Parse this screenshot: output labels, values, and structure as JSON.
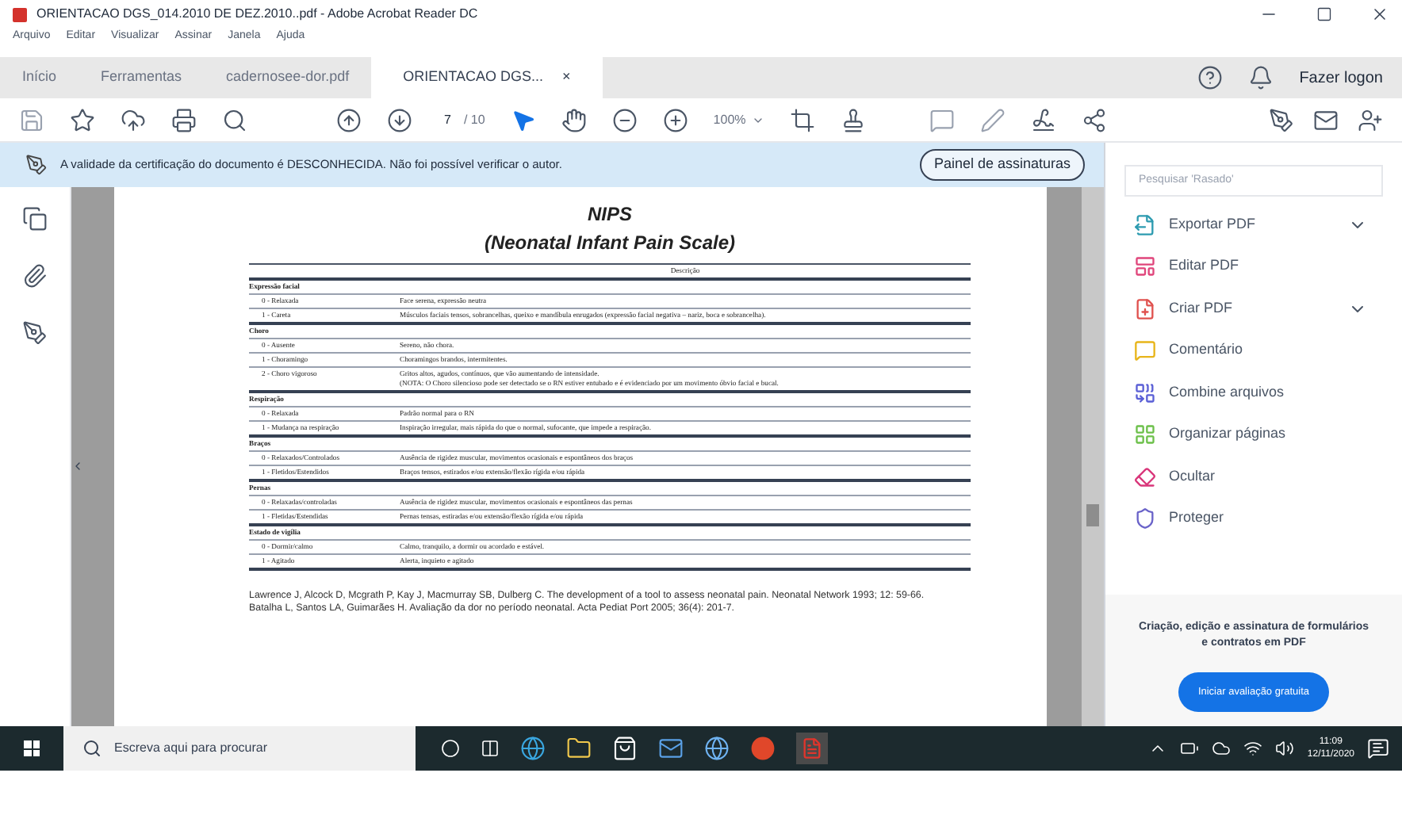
{
  "window": {
    "title": "ORIENTACAO DGS_014.2010 DE DEZ.2010..pdf - Adobe Acrobat Reader DC"
  },
  "menu": [
    "Arquivo",
    "Editar",
    "Visualizar",
    "Assinar",
    "Janela",
    "Ajuda"
  ],
  "tabs": [
    {
      "label": "Início",
      "selected": false
    },
    {
      "label": "Ferramentas",
      "selected": false
    },
    {
      "label": "cadernosee-dor.pdf",
      "selected": false
    },
    {
      "label": "ORIENTACAO DGS...",
      "selected": true,
      "close": "×"
    }
  ],
  "sign_in": "Fazer logon",
  "toolbar": {
    "page": "7",
    "page_total": "/ 10",
    "zoom": "100%"
  },
  "notification": {
    "text": "A validade da certificação do documento é DESCONHECIDA. Não foi possível verificar o autor.",
    "button": "Painel de assinaturas"
  },
  "document": {
    "title": "NIPS",
    "subtitle": "(Neonatal Infant Pain Scale)",
    "header": "Descrição",
    "sections": [
      {
        "name": "Expressão facial",
        "rows": [
          {
            "score": "0 - Relaxada",
            "description": "Face serena, expressão neutra"
          },
          {
            "score": "1 - Careta",
            "description": "Músculos faciais tensos, sobrancelhas, queixo e mandíbula enrugados (expressão facial negativa – nariz, boca e sobrancelha)."
          }
        ]
      },
      {
        "name": "Choro",
        "rows": [
          {
            "score": "0 - Ausente",
            "description": "Sereno, não chora."
          },
          {
            "score": "1 - Choramingo",
            "description": "Choramingos brandos, intermitentes."
          },
          {
            "score": "2 - Choro vigoroso",
            "description": "Gritos altos, agudos, contínuos, que vão aumentando de intensidade.",
            "note": "(NOTA: O Choro silencioso pode ser detectado se o RN estiver entubado e é evidenciado por um movimento óbvio facial e bucal."
          }
        ]
      },
      {
        "name": "Respiração",
        "rows": [
          {
            "score": "0 - Relaxada",
            "description": "Padrão normal para o RN"
          },
          {
            "score": "1 - Mudança na respiração",
            "description": "Inspiração irregular, mais rápida do que o normal, sufocante, que impede a respiração."
          }
        ]
      },
      {
        "name": "Braços",
        "rows": [
          {
            "score": "0 - Relaxados/Controlados",
            "description": "Ausência de rigidez muscular, movimentos ocasionais e espontâneos dos braços"
          },
          {
            "score": "1 - Fletidos/Estendidos",
            "description": "Braços tensos, estirados e/ou extensão/flexão rígida e/ou rápida"
          }
        ]
      },
      {
        "name": "Pernas",
        "rows": [
          {
            "score": "0 - Relaxadas/controladas",
            "description": "Ausência de rigidez muscular, movimentos ocasionais e espontâneos das pernas"
          },
          {
            "score": "1 - Fletidas/Estendidas",
            "description": "Pernas tensas, estiradas e/ou extensão/flexão rígida e/ou rápida"
          }
        ]
      },
      {
        "name": "Estado de vigília",
        "rows": [
          {
            "score": "0 - Dormir/calmo",
            "description": "Calmo, tranquilo, a dormir ou acordado e estável."
          },
          {
            "score": "1 - Agitado",
            "description": "Alerta, inquieto e agitado"
          }
        ]
      }
    ],
    "references": [
      "Lawrence J, Alcock D, Mcgrath P, Kay J, Macmurray SB, Dulberg C. The development of a tool to assess neonatal pain. Neonatal Network 1993; 12: 59-66.",
      "Batalha L, Santos LA, Guimarães H. Avaliação da dor no período neonatal. Acta Pediat Port 2005; 36(4): 201-7."
    ]
  },
  "tools_panel": {
    "search_placeholder": "Pesquisar 'Rasado'",
    "tools": [
      {
        "label": "Exportar PDF",
        "color": "#2d9bb0",
        "expandable": true
      },
      {
        "label": "Editar PDF",
        "color": "#e0457b",
        "expandable": false
      },
      {
        "label": "Criar PDF",
        "color": "#e0524f",
        "expandable": true
      },
      {
        "label": "Comentário",
        "color": "#e8b51a",
        "expandable": false
      },
      {
        "label": "Combine arquivos",
        "color": "#5a5fd6",
        "expandable": false
      },
      {
        "label": "Organizar páginas",
        "color": "#6cc04a",
        "expandable": false
      },
      {
        "label": "Ocultar",
        "color": "#d9367a",
        "expandable": false
      },
      {
        "label": "Proteger",
        "color": "#6a63c9",
        "expandable": false
      }
    ],
    "promo": "Criação, edição e assinatura de formulários e contratos em PDF",
    "promo_button": "Iniciar avaliação gratuita"
  },
  "taskbar": {
    "search_placeholder": "Escreva aqui para procurar",
    "time": "11:09",
    "date": "12/11/2020"
  }
}
